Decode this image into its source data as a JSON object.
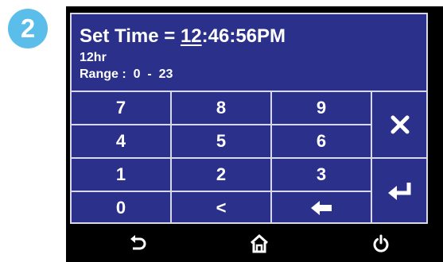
{
  "step_number": "2",
  "header": {
    "title_prefix": "Set Time = ",
    "hour": "12",
    "title_suffix": ":46:56PM",
    "mode": "12hr",
    "range": "Range :  0  -  23"
  },
  "keypad": {
    "keys": [
      "7",
      "8",
      "9",
      "4",
      "5",
      "6",
      "1",
      "2",
      "3",
      "0",
      "<"
    ]
  },
  "colors": {
    "screen_bg": "#2b318a",
    "grid_lines": "#d8d8e8",
    "badge": "#5bbde9",
    "bezel": "#000000"
  },
  "icons": {
    "backspace": "left-arrow-icon",
    "cancel": "close-icon",
    "enter": "enter-icon",
    "back": "back-icon",
    "home": "home-icon",
    "power": "power-icon"
  }
}
